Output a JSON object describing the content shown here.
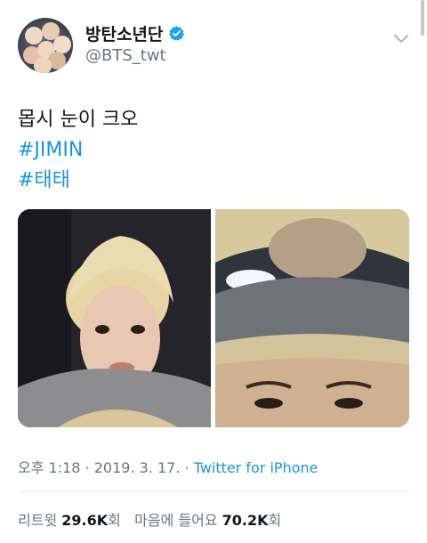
{
  "author": {
    "display_name": "방탄소년단",
    "handle": "@BTS_twt",
    "avatar_icon": "group-avatar",
    "verified_icon": "verified-badge-icon",
    "verified_color": "#1da1f2"
  },
  "tweet": {
    "text": "몹시 눈이 크오",
    "hashtags": [
      "#JIMIN",
      "#태태"
    ]
  },
  "media": {
    "photos": [
      {
        "name": "photo-jimin"
      },
      {
        "name": "photo-taehyung"
      }
    ]
  },
  "meta": {
    "time": "오후 1:18",
    "separator": " · ",
    "date": "2019. 3. 17.",
    "source": "Twitter for iPhone"
  },
  "stats": {
    "retweets_label": "리트윗",
    "retweets_count": "29.6K",
    "retweets_suffix": "회",
    "likes_label": "마음에 들어요",
    "likes_count": "70.2K",
    "likes_suffix": "회"
  },
  "colors": {
    "link": "#1b95e0",
    "muted": "#657786",
    "text": "#14171a"
  }
}
